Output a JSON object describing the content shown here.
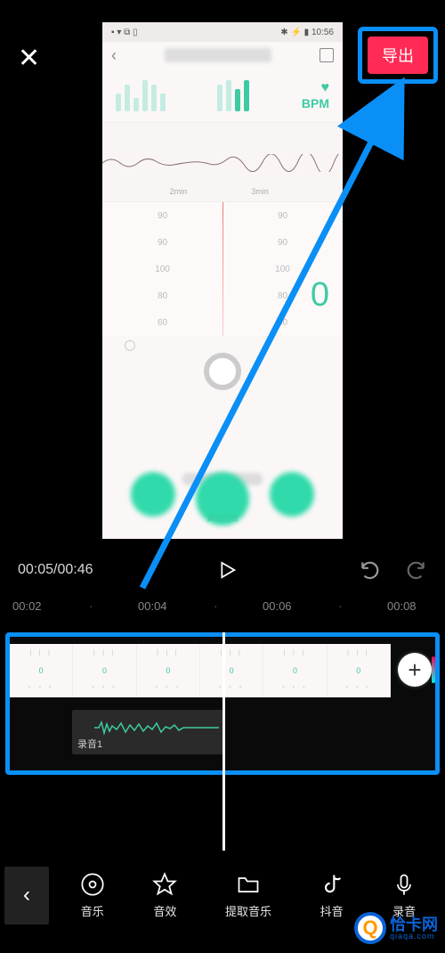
{
  "header": {
    "close_symbol": "✕",
    "export_label": "导出"
  },
  "preview": {
    "status_time": "10:56",
    "back_symbol": "‹",
    "bpm_label": "BPM",
    "axis_left": "2min",
    "axis_right": "3min",
    "scale_upper": [
      "90",
      "90",
      "90",
      "90"
    ],
    "scale_lower": [
      "100",
      "100",
      "80",
      "80",
      "60",
      "60"
    ],
    "big_value": "0",
    "bottom_caption": "算练回数"
  },
  "player": {
    "current": "00:05",
    "total": "00:46"
  },
  "ruler": {
    "ticks": [
      "00:02",
      "00:04",
      "00:06",
      "00:08"
    ]
  },
  "timeline": {
    "add_symbol": "+",
    "audio_label": "录音1",
    "thumb_value": "0"
  },
  "toolbar": {
    "back_symbol": "‹",
    "items": [
      {
        "label": "音乐",
        "icon": "music"
      },
      {
        "label": "音效",
        "icon": "star"
      },
      {
        "label": "提取音乐",
        "icon": "folder"
      },
      {
        "label": "抖音",
        "icon": "tiktok"
      },
      {
        "label": "录音",
        "icon": "mic"
      }
    ]
  },
  "watermark": {
    "q": "Q",
    "cn": "恰卡网",
    "py": "qiaqa.com"
  }
}
